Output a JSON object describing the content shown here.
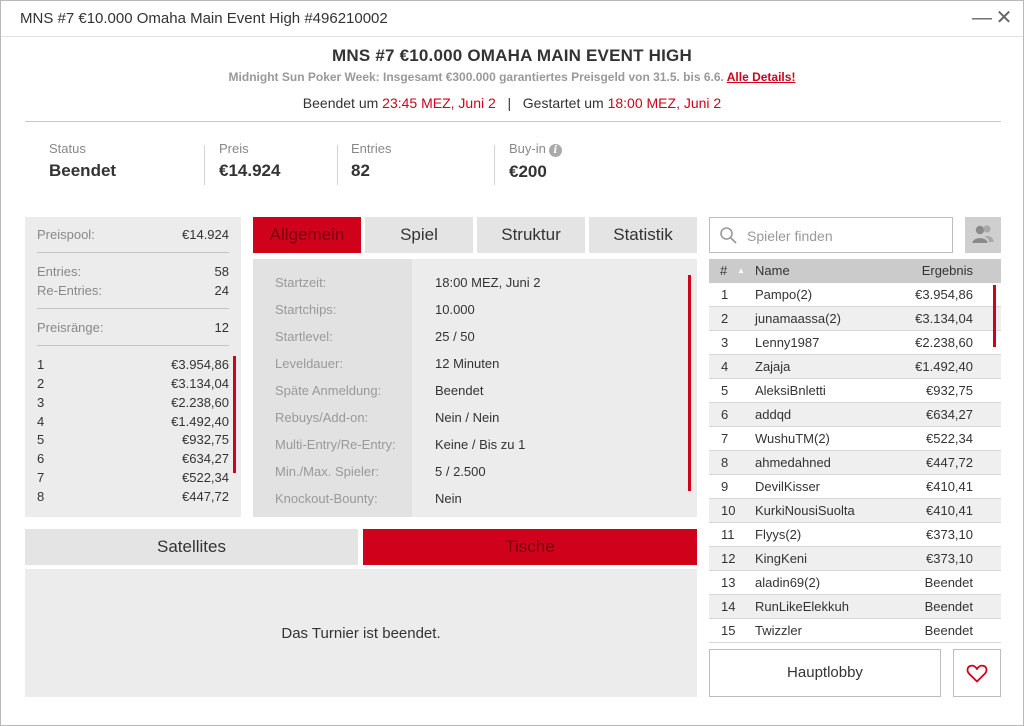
{
  "window": {
    "title": "MNS #7 €10.000 Omaha Main Event High #496210002",
    "minimize_label": "—",
    "close_label": "✕"
  },
  "header": {
    "title": "MNS #7 €10.000 OMAHA MAIN EVENT HIGH",
    "subtitle": "Midnight Sun Poker Week: Insgesamt €300.000 garantiertes Preisgeld von 31.5. bis 6.6.",
    "details_link": "Alle Details!",
    "ended_label": "Beendet um",
    "ended_time": "23:45 MEZ, Juni 2",
    "divider": "|",
    "started_label": "Gestartet um",
    "started_time": "18:00 MEZ, Juni 2"
  },
  "stats": [
    {
      "label": "Status",
      "value": "Beendet"
    },
    {
      "label": "Preis",
      "value": "€14.924"
    },
    {
      "label": "Entries",
      "value": "82"
    },
    {
      "label": "Buy-in",
      "value": "€200"
    }
  ],
  "prize_panel": {
    "pool_label": "Preispool:",
    "pool_value": "€14.924",
    "entries_label": "Entries:",
    "entries_value": "58",
    "reentries_label": "Re-Entries:",
    "reentries_value": "24",
    "ranks_label": "Preisränge:",
    "ranks_value": "12",
    "places": [
      {
        "rank": "1",
        "prize": "€3.954,86"
      },
      {
        "rank": "2",
        "prize": "€3.134,04"
      },
      {
        "rank": "3",
        "prize": "€2.238,60"
      },
      {
        "rank": "4",
        "prize": "€1.492,40"
      },
      {
        "rank": "5",
        "prize": "€932,75"
      },
      {
        "rank": "6",
        "prize": "€634,27"
      },
      {
        "rank": "7",
        "prize": "€522,34"
      },
      {
        "rank": "8",
        "prize": "€447,72"
      }
    ]
  },
  "tabs": [
    "Allgemein",
    "Spiel",
    "Struktur",
    "Statistik"
  ],
  "details": [
    {
      "label": "Startzeit:",
      "value": "18:00 MEZ, Juni 2"
    },
    {
      "label": "Startchips:",
      "value": "10.000"
    },
    {
      "label": "Startlevel:",
      "value": "25 / 50"
    },
    {
      "label": "Leveldauer:",
      "value": "12 Minuten"
    },
    {
      "label": "Späte Anmeldung:",
      "value": "Beendet"
    },
    {
      "label": "Rebuys/Add-on:",
      "value": "Nein / Nein"
    },
    {
      "label": "Multi-Entry/Re-Entry:",
      "value": "Keine / Bis zu 1"
    },
    {
      "label": "Min./Max. Spieler:",
      "value": "5 / 2.500"
    },
    {
      "label": "Knockout-Bounty:",
      "value": "Nein"
    }
  ],
  "bottom_tabs": {
    "satellites": "Satellites",
    "tables": "Tische"
  },
  "ended_message": "Das Turnier ist beendet.",
  "player_search": {
    "placeholder": "Spieler finden"
  },
  "player_list": {
    "col_rank": "#",
    "sort_indicator": "▲",
    "col_name": "Name",
    "col_result": "Ergebnis",
    "rows": [
      {
        "rank": "1",
        "name": "Pampo(2)",
        "result": "€3.954,86"
      },
      {
        "rank": "2",
        "name": "junamaassa(2)",
        "result": "€3.134,04"
      },
      {
        "rank": "3",
        "name": "Lenny1987",
        "result": "€2.238,60"
      },
      {
        "rank": "4",
        "name": "Zajaja",
        "result": "€1.492,40"
      },
      {
        "rank": "5",
        "name": "AleksiBnletti",
        "result": "€932,75"
      },
      {
        "rank": "6",
        "name": "addqd",
        "result": "€634,27"
      },
      {
        "rank": "7",
        "name": "WushuTM(2)",
        "result": "€522,34"
      },
      {
        "rank": "8",
        "name": "ahmedahned",
        "result": "€447,72"
      },
      {
        "rank": "9",
        "name": "DevilKisser",
        "result": "€410,41"
      },
      {
        "rank": "10",
        "name": "KurkiNousiSuolta",
        "result": "€410,41"
      },
      {
        "rank": "11",
        "name": "Flyys(2)",
        "result": "€373,10"
      },
      {
        "rank": "12",
        "name": "KingKeni",
        "result": "€373,10"
      },
      {
        "rank": "13",
        "name": "aladin69(2)",
        "result": "Beendet"
      },
      {
        "rank": "14",
        "name": "RunLikeElekkuh",
        "result": "Beendet"
      },
      {
        "rank": "15",
        "name": "Twizzler",
        "result": "Beendet"
      }
    ]
  },
  "buttons": {
    "main_lobby": "Hauptlobby"
  },
  "colors": {
    "accent": "#d0021b",
    "panel": "#ececec",
    "tab": "#e4e4e4"
  }
}
